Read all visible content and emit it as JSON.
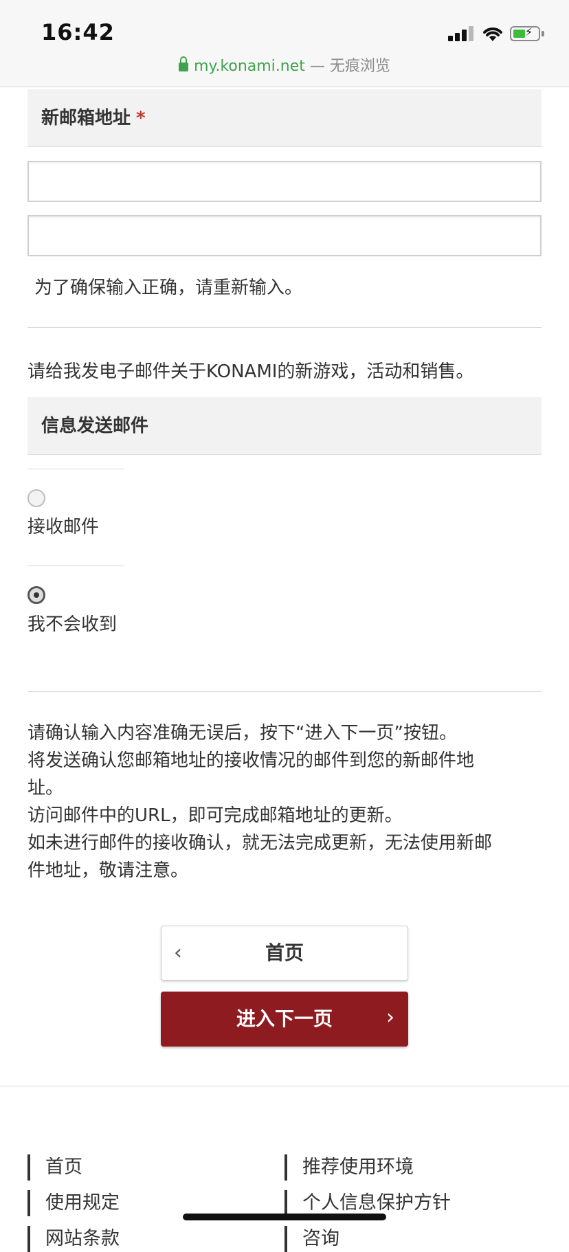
{
  "status_bar": {
    "time": "16:42",
    "url_domain": "my.konami.net",
    "url_suffix": " — 无痕浏览",
    "icons": [
      "signal-icon",
      "wifi-icon",
      "battery-charging-icon"
    ]
  },
  "form": {
    "email_section": {
      "title": "新邮箱地址",
      "required_mark": "*",
      "input_value": "",
      "confirm_input_value": "",
      "hint": "为了确保输入正确，请重新输入。"
    },
    "newsletter_text": "请给我发电子邮件关于KONAMI的新游戏，活动和销售。",
    "mail_section": {
      "title": "信息发送邮件",
      "options": [
        {
          "label": "接收邮件",
          "checked": false
        },
        {
          "label": "我不会收到",
          "checked": true
        }
      ]
    },
    "notice_lines": [
      "请确认输入内容准确无误后，按下“进入下一页”按钮。",
      "将发送确认您邮箱地址的接收情况的邮件到您的新邮件地",
      "址。",
      "访问邮件中的URL，即可完成邮箱地址的更新。",
      "如未进行邮件的接收确认，就无法完成更新，无法使用新邮",
      "件地址，敬请注意。"
    ]
  },
  "buttons": {
    "home_label": "首页",
    "next_label": "进入下一页"
  },
  "footer": {
    "links_left": [
      "首页",
      "使用规定",
      "网站条款"
    ],
    "links_right": [
      "推荐使用环境",
      "个人信息保护方针",
      "咨询"
    ]
  },
  "colors": {
    "primary_button": "#8e1b1f",
    "required": "#c0392b",
    "secure_url": "#3fa34d"
  }
}
